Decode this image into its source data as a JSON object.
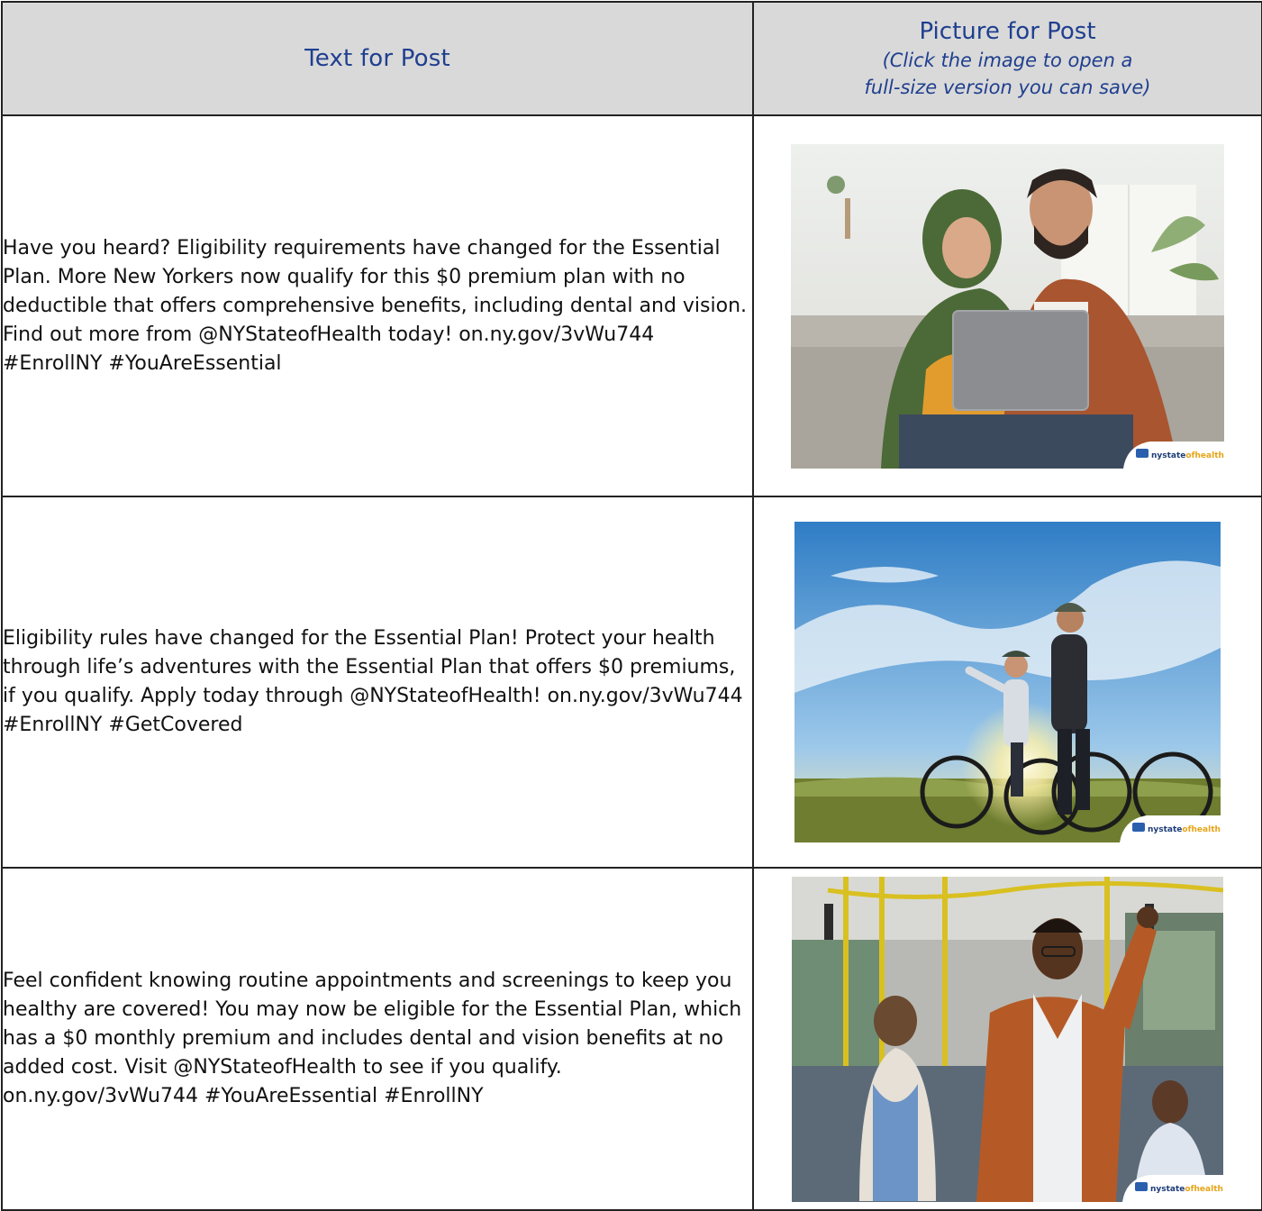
{
  "header": {
    "text_col": "Text for Post",
    "pic_col_title": "Picture for Post",
    "pic_col_note_1": "(Click the image to open a",
    "pic_col_note_2": "full-size version you can save)"
  },
  "rows": [
    {
      "text": "Have you heard? Eligibility requirements have changed for the Essential Plan. More New Yorkers now qualify for this $0 premium plan with no deductible that offers comprehensive benefits, including dental and vision. Find out more from @NYStateofHealth today! on.ny.gov/3vWu744 #EnrollNY #YouAreEssential",
      "image": "couple-on-couch-with-laptop-photo"
    },
    {
      "text": "Eligibility rules have changed for the Essential Plan! Protect your health through life’s adventures with the Essential Plan that offers $0 premiums, if you qualify. Apply today through @NYStateofHealth! on.ny.gov/3vWu744 #EnrollNY #GetCovered",
      "image": "cyclists-at-sunset-photo"
    },
    {
      "text": "Feel confident knowing routine appointments and screenings to keep you healthy are covered! You may now be eligible for the Essential Plan, which has a $0 monthly premium and includes dental and vision benefits at no added cost. Visit @NYStateofHealth to see if you qualify. on.ny.gov/3vWu744 #YouAreEssential #EnrollNY",
      "image": "man-on-bus-photo"
    }
  ],
  "logo": {
    "part1": "nystate",
    "part2": "ofhealth"
  },
  "colors": {
    "header_bg": "#d9d9d9",
    "header_text": "#1f3f8f",
    "logo_blue": "#1d3c78",
    "logo_gold": "#e6a417"
  }
}
